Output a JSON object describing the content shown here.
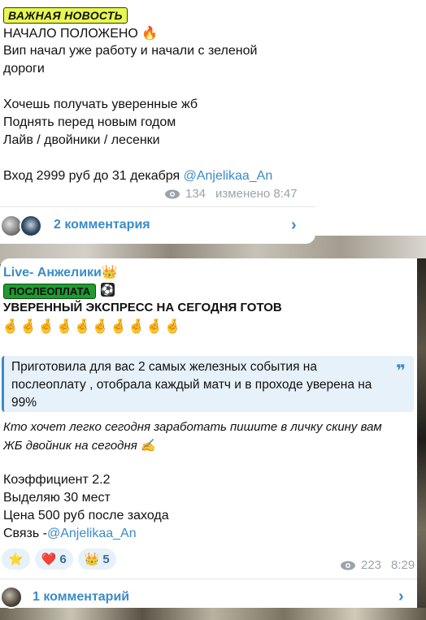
{
  "post1": {
    "badge": "ВАЖНАЯ НОВОСТЬ",
    "lines": [
      "НАЧАЛО ПОЛОЖЕНО 🔥",
      "Вип начал уже работу и начали с зеленой",
      "дороги",
      "",
      " Хочешь получать уверенные жб",
      "Поднять перед новым годом",
      "Лайв / двойники / лесенки",
      "",
      "Вход 2999 руб до 31 декабря "
    ],
    "link": "@Anjelikaa_An",
    "views": "134",
    "time": "изменено 8:47",
    "comments": "2 комментария"
  },
  "post2": {
    "channel": "Live- Анжелики👑",
    "badge": "ПОСЛЕОПЛАТА",
    "ball": "⚽",
    "headline": "УВЕРЕННЫЙ ЭКСПРЕСС  НА СЕГОДНЯ ГОТОВ",
    "emoji_row": "🤞🤞🤞🤞🤞🤞🤞🤞🤞🤞",
    "quote": "Приготовила для вас 2 самых железных события на послеоплату , отобрала каждый матч и в проходе уверена на 99%",
    "italic1": "Кто хочет легко сегодня заработать пишите в личку скину вам",
    "italic2": "ЖБ двойник на сегодня ✍️",
    "lines": [
      "Коэффициент 2.2",
      "Выделяю 30 мест",
      "Цена 500 руб после захода",
      "Связь -"
    ],
    "link": "@Anjelikaa_An",
    "reactions": [
      {
        "emoji": "⭐",
        "count": ""
      },
      {
        "emoji": "❤️",
        "count": "6"
      },
      {
        "emoji": "👑",
        "count": "5"
      }
    ],
    "views": "223",
    "time": "8:29",
    "comments": "1 комментарий"
  },
  "colors": {
    "accent": "#3a8bc9",
    "quote_bg": "#e6f1fa",
    "badge_news": "#e8f84e",
    "badge_post": "#1f9a2f"
  }
}
